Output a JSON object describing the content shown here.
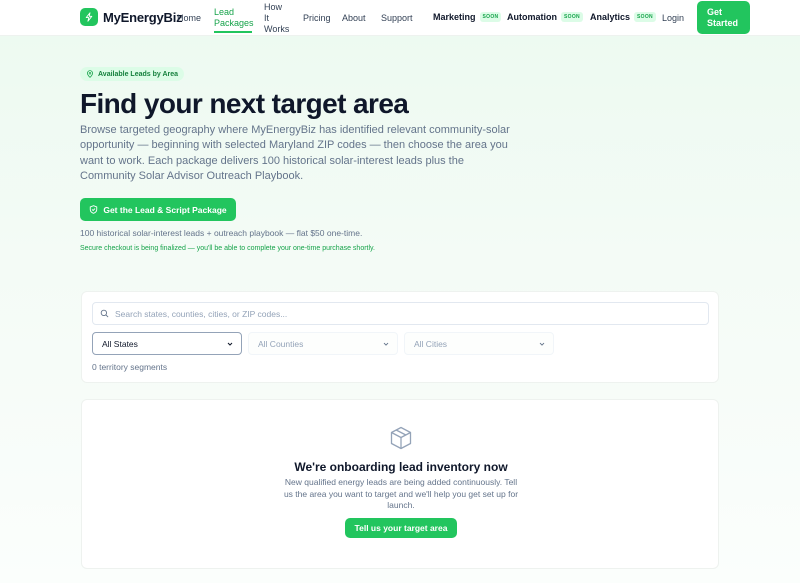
{
  "nav": {
    "brand": "MyEnergyBiz",
    "links": [
      {
        "label": "Home"
      },
      {
        "label": "Lead Packages",
        "active": true
      },
      {
        "label": "How It Works"
      },
      {
        "label": "Pricing"
      },
      {
        "label": "About"
      },
      {
        "label": "Support"
      }
    ],
    "soon_items": [
      {
        "label": "Marketing",
        "badge": "SOON"
      },
      {
        "label": "Automation",
        "badge": "SOON"
      },
      {
        "label": "Analytics",
        "badge": "SOON"
      }
    ],
    "login": "Login",
    "cta": "Get Started"
  },
  "hero": {
    "pill": "Available Leads by Area",
    "title": "Find your next target area",
    "subtitle": "Browse targeted geography where MyEnergyBiz has identified relevant community-solar opportunity — beginning with selected Maryland ZIP codes — then choose the area you want to work. Each package delivers 100 historical solar-interest leads plus the Community Solar Advisor Outreach Playbook.",
    "cta": "Get the Lead & Script Package",
    "price_note": "100 historical solar-interest leads + outreach playbook — flat $50 one-time.",
    "checkout_note": "Secure checkout is being finalized — you'll be able to complete your one-time purchase shortly."
  },
  "filters": {
    "search_placeholder": "Search states, counties, cities, or ZIP codes...",
    "state": "All States",
    "county": "All Counties",
    "city": "All Cities",
    "segment_count": "0 territory segments"
  },
  "empty": {
    "title": "We're onboarding lead inventory now",
    "description": "New qualified energy leads are being added continuously. Tell us the area you want to target and we'll help you get set up for launch.",
    "cta": "Tell us your target area"
  },
  "colors": {
    "accent": "#22c55e",
    "accent_text": "#16a34a",
    "badge_bg": "#dcfce7"
  }
}
